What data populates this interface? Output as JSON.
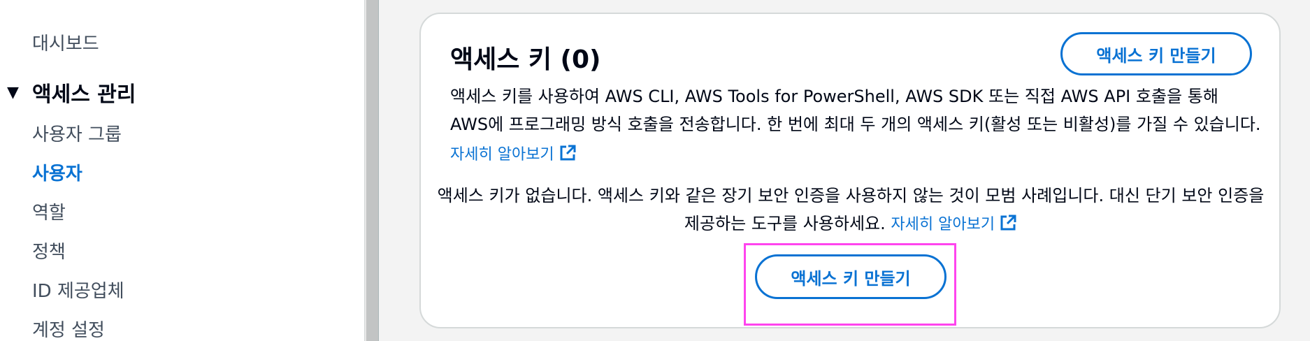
{
  "sidebar": {
    "dashboard": "대시보드",
    "section_title": "액세스 관리",
    "items": [
      {
        "label": "사용자 그룹",
        "active": false
      },
      {
        "label": "사용자",
        "active": true
      },
      {
        "label": "역할",
        "active": false
      },
      {
        "label": "정책",
        "active": false
      },
      {
        "label": "ID 제공업체",
        "active": false
      },
      {
        "label": "계정 설정",
        "active": false
      }
    ]
  },
  "card": {
    "title": "액세스 키 (0)",
    "create_button_label": "액세스 키 만들기",
    "description": "액세스 키를 사용하여 AWS CLI, AWS Tools for PowerShell, AWS SDK 또는 직접 AWS API 호출을 통해 AWS에 프로그래밍 방식 호출을 전송합니다. 한 번에 최대 두 개의 액세스 키(활성 또는 비활성)를 가질 수 있습니다.",
    "learn_more": "자세히 알아보기",
    "empty_message": "액세스 키가 없습니다. 액세스 키와 같은 장기 보안 인증을 사용하지 않는 것이 모범 사례입니다. 대신 단기 보안 인증을 제공하는 도구를 사용하세요.",
    "empty_learn_more": "자세히 알아보기",
    "empty_create_button_label": "액세스 키 만들기"
  },
  "colors": {
    "accent": "#0972d3",
    "highlight": "#ff44ee"
  },
  "icons": {
    "section_caret": "caret-down-icon",
    "external_link": "external-link-icon"
  }
}
